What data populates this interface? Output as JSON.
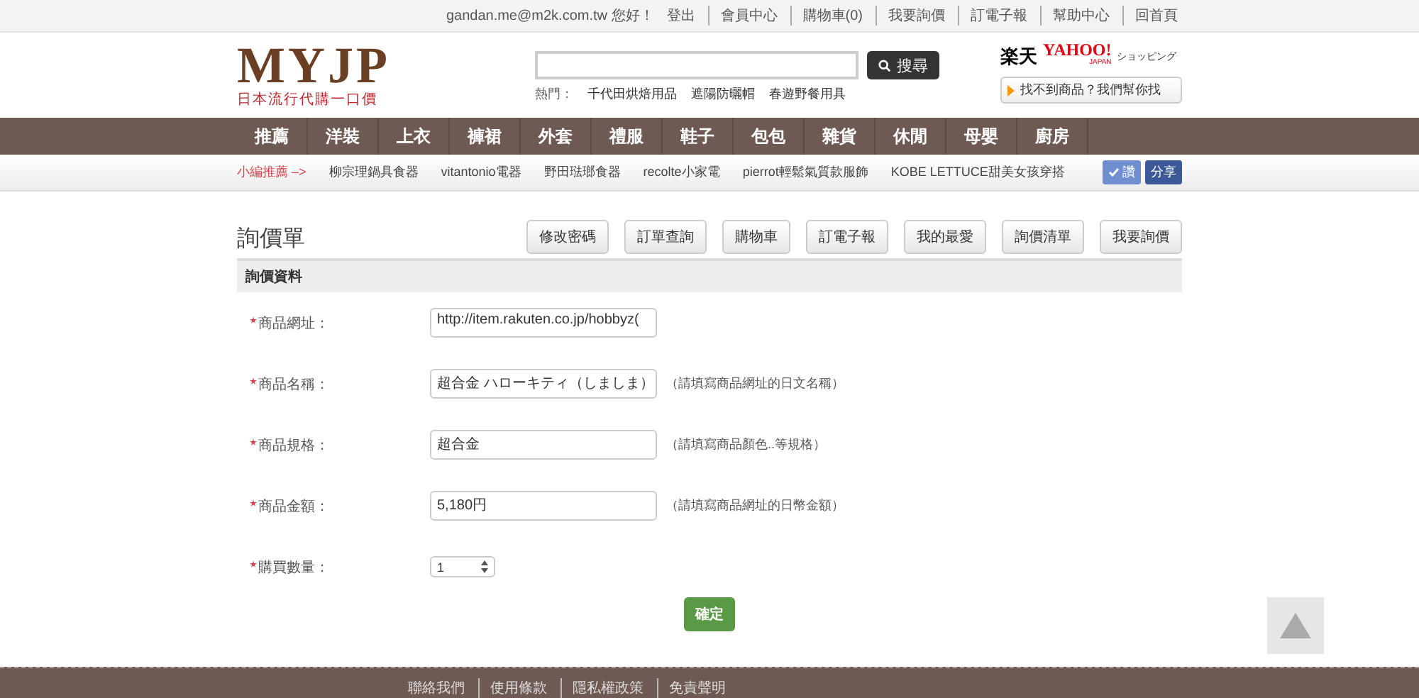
{
  "top_bar": {
    "greeting": "gandan.me@m2k.com.tw 您好！",
    "links": [
      "登出",
      "會員中心",
      "購物車(0)",
      "我要詢價",
      "訂電子報",
      "幫助中心",
      "回首頁"
    ]
  },
  "header": {
    "logo": {
      "title": "MYJP",
      "subtitle": "日本流行代購一口價"
    },
    "search": {
      "button": "搜尋",
      "hot_label": "熱門：",
      "hot_terms": [
        "千代田烘焙用品",
        "遮陽防曬帽",
        "春遊野餐用具"
      ]
    },
    "partners": {
      "rakuten": "楽天",
      "yahoo": "YAHOO!",
      "yahoo_sub": "JAPAN",
      "shopping": "ショッピング",
      "help_button": "找不到商品？我們幫你找"
    }
  },
  "nav": [
    "推薦",
    "洋裝",
    "上衣",
    "褲裙",
    "外套",
    "禮服",
    "鞋子",
    "包包",
    "雜貨",
    "休閒",
    "母嬰",
    "廚房"
  ],
  "sub_nav": {
    "label": "小編推薦 –>",
    "links": [
      "柳宗理鍋具食器",
      "vitantonio電器",
      "野田琺瑯食器",
      "recolte小家電",
      "pierrot輕鬆氣質款服飾",
      "KOBE LETTUCE甜美女孩穿搭"
    ],
    "like_button": "讚",
    "share_button": "分享"
  },
  "page": {
    "title": "詢價單",
    "buttons": [
      "修改密碼",
      "訂單查詢",
      "購物車",
      "訂電子報",
      "我的最愛",
      "詢價清單",
      "我要詢價"
    ],
    "section": "詢價資料"
  },
  "form": [
    {
      "kind": "text",
      "required": true,
      "label": "商品網址：",
      "value": "http://item.rakuten.co.jp/hobbyz("
    },
    {
      "kind": "text",
      "required": true,
      "label": "商品名稱：",
      "value": "超合金 ハローキティ（しましま）",
      "hint": "（請填寫商品網址的日文名稱）"
    },
    {
      "kind": "text",
      "required": true,
      "label": "商品規格：",
      "value": "超合金",
      "hint": "（請填寫商品顏色..等規格）"
    },
    {
      "kind": "text",
      "required": true,
      "label": "商品金額：",
      "value": "5,180円",
      "hint": "（請填寫商品網址的日幣金額）"
    },
    {
      "kind": "select",
      "required": true,
      "label": "購買數量：",
      "value": "1"
    }
  ],
  "submit": "確定",
  "footer": [
    "聯絡我們",
    "使用條款",
    "隱私權政策",
    "免責聲明"
  ]
}
